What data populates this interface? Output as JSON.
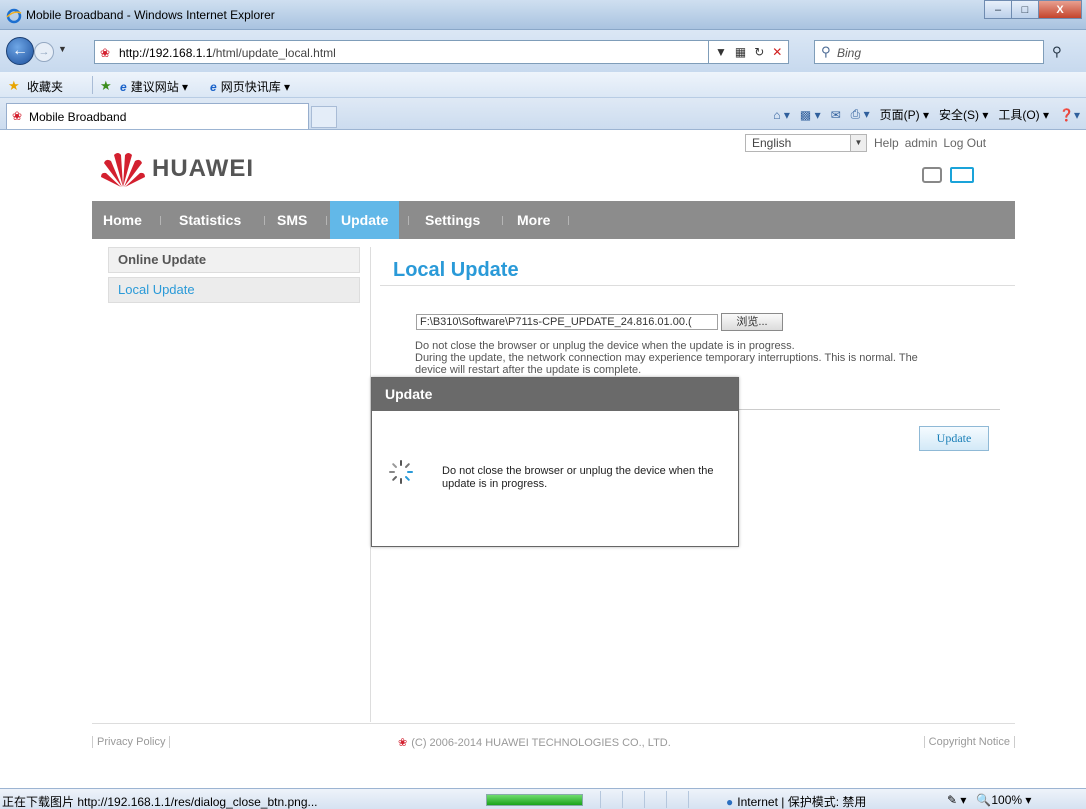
{
  "window": {
    "title": "Mobile Broadband - Windows Internet Explorer",
    "minimize": "–",
    "maximize": "□",
    "close": "X"
  },
  "address_bar": {
    "url_host": "http://192.168.1.1",
    "url_path": "/html/update_local.html",
    "search_placeholder": "Bing"
  },
  "favorites_bar": {
    "label": "收藏夹",
    "items": [
      "建议网站 ▾",
      "网页快讯库 ▾"
    ]
  },
  "tab": {
    "label": "Mobile Broadband"
  },
  "command_bar": {
    "page": "页面(P) ▾",
    "safety": "安全(S) ▾",
    "tools": "工具(O) ▾"
  },
  "header": {
    "brand": "HUAWEI",
    "language": "English",
    "help": "Help",
    "user": "admin",
    "logout": "Log Out"
  },
  "nav": {
    "items": [
      "Home",
      "Statistics",
      "SMS",
      "Update",
      "Settings",
      "More"
    ],
    "active": "Update"
  },
  "sidebar": {
    "items": [
      "Online Update",
      "Local Update"
    ]
  },
  "main": {
    "title": "Local Update",
    "file_path": "F:\\B310\\Software\\P711s-CPE_UPDATE_24.816.01.00.(",
    "browse_label": "浏览...",
    "note_line1": "Do not close the browser or unplug the device when the update is in progress.",
    "note_line2": "During the update, the network connection may experience temporary interruptions. This is normal. The",
    "note_line3": "device will restart after the update is complete.",
    "update_button": "Update"
  },
  "modal": {
    "title": "Update",
    "message": "Do not close the browser or unplug the device when the update is in progress."
  },
  "footer": {
    "privacy": "Privacy Policy",
    "copyright": "(C) 2006-2014 HUAWEI TECHNOLOGIES CO., LTD.",
    "copyright_notice": "Copyright Notice"
  },
  "status_bar": {
    "text": "正在下载图片 http://192.168.1.1/res/dialog_close_btn.png...",
    "zone": "Internet | 保护模式: 禁用",
    "zoom": "100%",
    "progress": 1.0
  },
  "colors": {
    "accent": "#2a9ad8",
    "nav_bg": "#8c8c8c",
    "nav_active": "#62b8e8",
    "brand_red": "#d3202f",
    "modal_header": "#6a6a6a"
  }
}
